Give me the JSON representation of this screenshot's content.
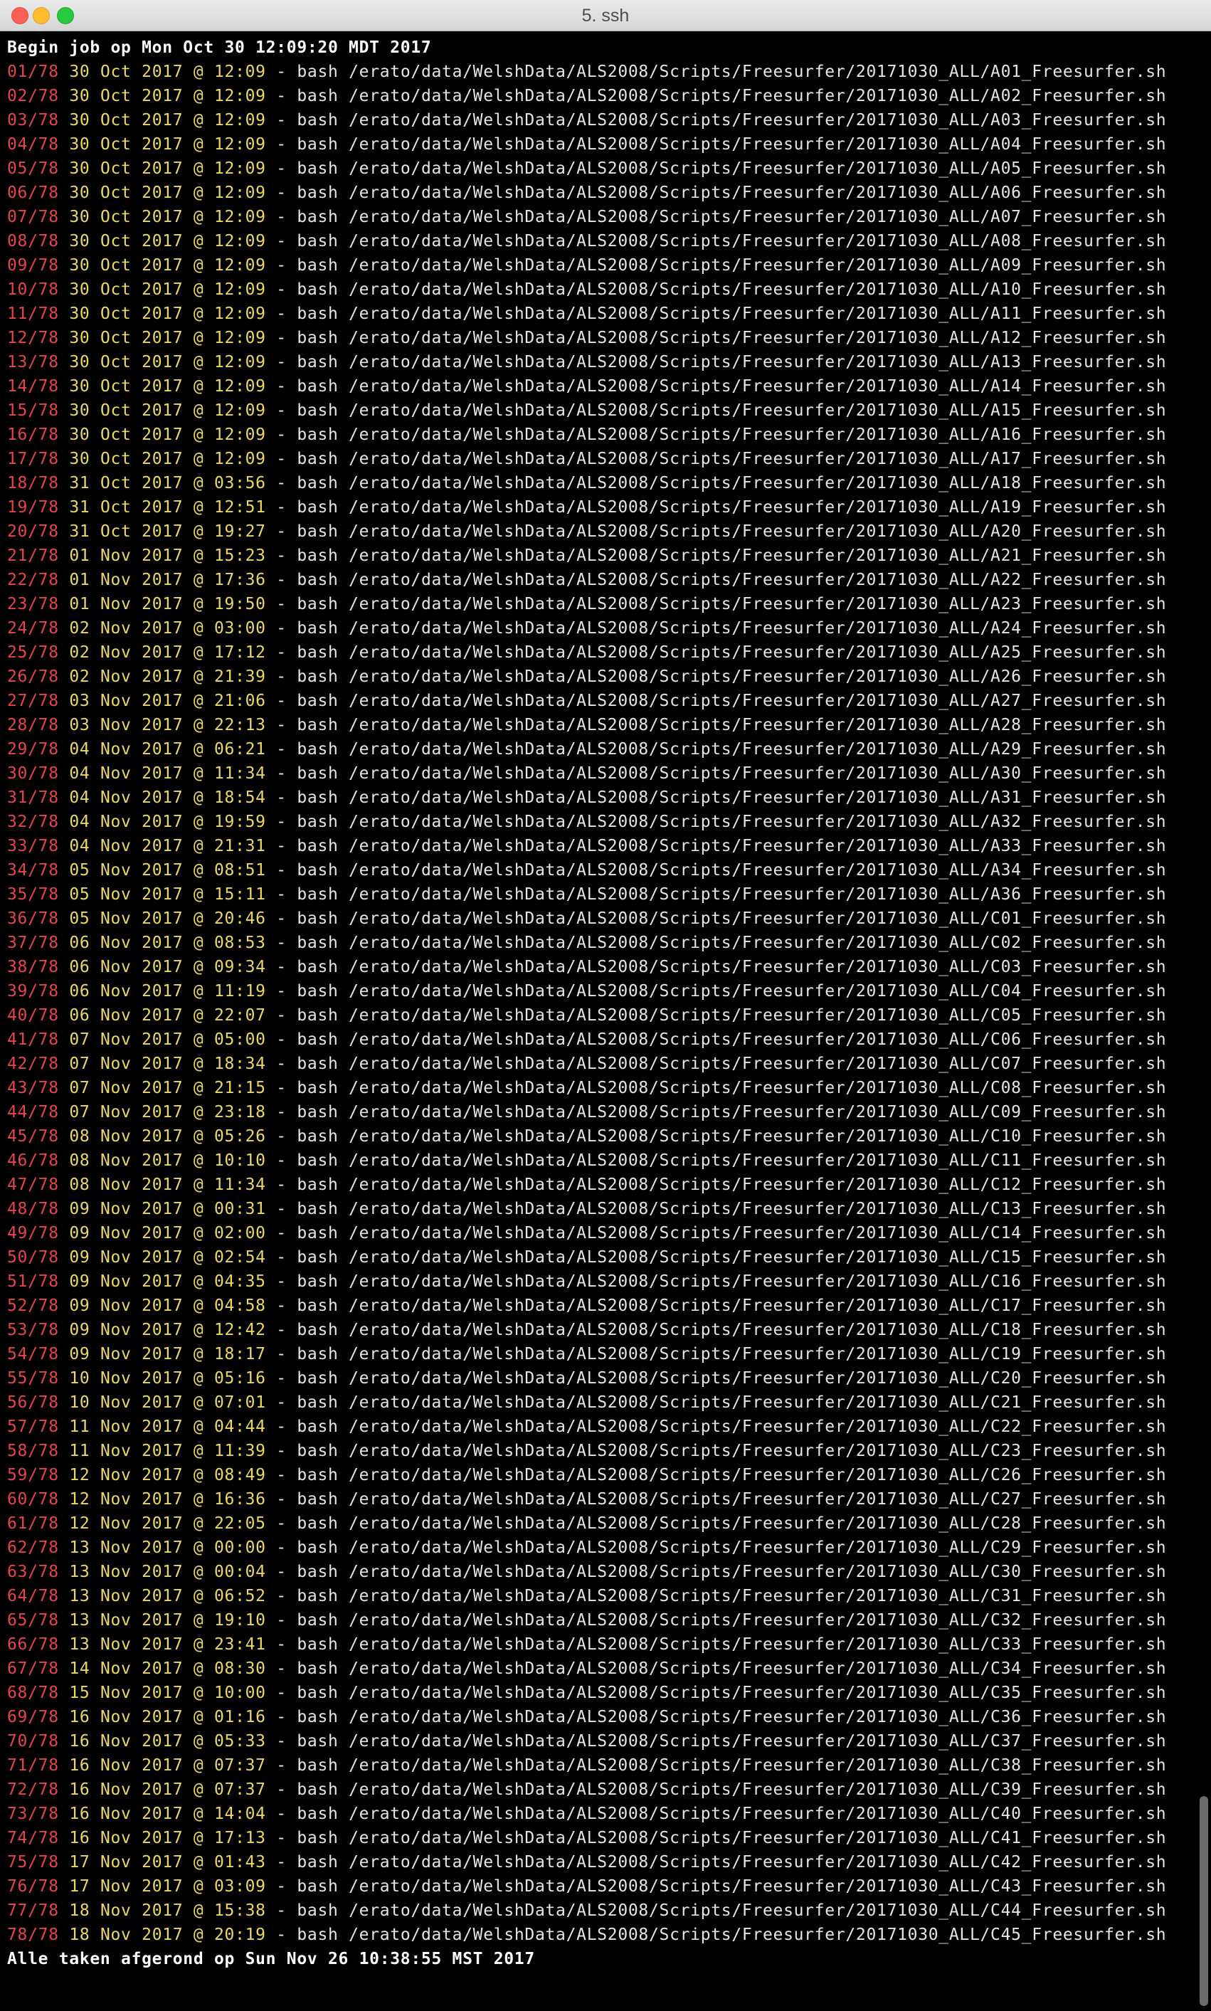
{
  "window": {
    "title": "5. ssh"
  },
  "terminal": {
    "header": "Begin job op Mon Oct 30 12:09:20 MDT 2017",
    "footer": "Alle taken afgerond op Sun Nov 26 10:38:55 MST 2017",
    "separator": " - ",
    "colors": {
      "background": "#000000",
      "index": "#e8434a",
      "date": "#ecd85f",
      "text": "#e5e5e5"
    },
    "jobs": [
      {
        "idx": "01/78",
        "date": "30 Oct 2017 @ 12:09",
        "cmd": "bash /erato/data/WelshData/ALS2008/Scripts/Freesurfer/20171030_ALL/A01_Freesurfer.sh"
      },
      {
        "idx": "02/78",
        "date": "30 Oct 2017 @ 12:09",
        "cmd": "bash /erato/data/WelshData/ALS2008/Scripts/Freesurfer/20171030_ALL/A02_Freesurfer.sh"
      },
      {
        "idx": "03/78",
        "date": "30 Oct 2017 @ 12:09",
        "cmd": "bash /erato/data/WelshData/ALS2008/Scripts/Freesurfer/20171030_ALL/A03_Freesurfer.sh"
      },
      {
        "idx": "04/78",
        "date": "30 Oct 2017 @ 12:09",
        "cmd": "bash /erato/data/WelshData/ALS2008/Scripts/Freesurfer/20171030_ALL/A04_Freesurfer.sh"
      },
      {
        "idx": "05/78",
        "date": "30 Oct 2017 @ 12:09",
        "cmd": "bash /erato/data/WelshData/ALS2008/Scripts/Freesurfer/20171030_ALL/A05_Freesurfer.sh"
      },
      {
        "idx": "06/78",
        "date": "30 Oct 2017 @ 12:09",
        "cmd": "bash /erato/data/WelshData/ALS2008/Scripts/Freesurfer/20171030_ALL/A06_Freesurfer.sh"
      },
      {
        "idx": "07/78",
        "date": "30 Oct 2017 @ 12:09",
        "cmd": "bash /erato/data/WelshData/ALS2008/Scripts/Freesurfer/20171030_ALL/A07_Freesurfer.sh"
      },
      {
        "idx": "08/78",
        "date": "30 Oct 2017 @ 12:09",
        "cmd": "bash /erato/data/WelshData/ALS2008/Scripts/Freesurfer/20171030_ALL/A08_Freesurfer.sh"
      },
      {
        "idx": "09/78",
        "date": "30 Oct 2017 @ 12:09",
        "cmd": "bash /erato/data/WelshData/ALS2008/Scripts/Freesurfer/20171030_ALL/A09_Freesurfer.sh"
      },
      {
        "idx": "10/78",
        "date": "30 Oct 2017 @ 12:09",
        "cmd": "bash /erato/data/WelshData/ALS2008/Scripts/Freesurfer/20171030_ALL/A10_Freesurfer.sh"
      },
      {
        "idx": "11/78",
        "date": "30 Oct 2017 @ 12:09",
        "cmd": "bash /erato/data/WelshData/ALS2008/Scripts/Freesurfer/20171030_ALL/A11_Freesurfer.sh"
      },
      {
        "idx": "12/78",
        "date": "30 Oct 2017 @ 12:09",
        "cmd": "bash /erato/data/WelshData/ALS2008/Scripts/Freesurfer/20171030_ALL/A12_Freesurfer.sh"
      },
      {
        "idx": "13/78",
        "date": "30 Oct 2017 @ 12:09",
        "cmd": "bash /erato/data/WelshData/ALS2008/Scripts/Freesurfer/20171030_ALL/A13_Freesurfer.sh"
      },
      {
        "idx": "14/78",
        "date": "30 Oct 2017 @ 12:09",
        "cmd": "bash /erato/data/WelshData/ALS2008/Scripts/Freesurfer/20171030_ALL/A14_Freesurfer.sh"
      },
      {
        "idx": "15/78",
        "date": "30 Oct 2017 @ 12:09",
        "cmd": "bash /erato/data/WelshData/ALS2008/Scripts/Freesurfer/20171030_ALL/A15_Freesurfer.sh"
      },
      {
        "idx": "16/78",
        "date": "30 Oct 2017 @ 12:09",
        "cmd": "bash /erato/data/WelshData/ALS2008/Scripts/Freesurfer/20171030_ALL/A16_Freesurfer.sh"
      },
      {
        "idx": "17/78",
        "date": "30 Oct 2017 @ 12:09",
        "cmd": "bash /erato/data/WelshData/ALS2008/Scripts/Freesurfer/20171030_ALL/A17_Freesurfer.sh"
      },
      {
        "idx": "18/78",
        "date": "31 Oct 2017 @ 03:56",
        "cmd": "bash /erato/data/WelshData/ALS2008/Scripts/Freesurfer/20171030_ALL/A18_Freesurfer.sh"
      },
      {
        "idx": "19/78",
        "date": "31 Oct 2017 @ 12:51",
        "cmd": "bash /erato/data/WelshData/ALS2008/Scripts/Freesurfer/20171030_ALL/A19_Freesurfer.sh"
      },
      {
        "idx": "20/78",
        "date": "31 Oct 2017 @ 19:27",
        "cmd": "bash /erato/data/WelshData/ALS2008/Scripts/Freesurfer/20171030_ALL/A20_Freesurfer.sh"
      },
      {
        "idx": "21/78",
        "date": "01 Nov 2017 @ 15:23",
        "cmd": "bash /erato/data/WelshData/ALS2008/Scripts/Freesurfer/20171030_ALL/A21_Freesurfer.sh"
      },
      {
        "idx": "22/78",
        "date": "01 Nov 2017 @ 17:36",
        "cmd": "bash /erato/data/WelshData/ALS2008/Scripts/Freesurfer/20171030_ALL/A22_Freesurfer.sh"
      },
      {
        "idx": "23/78",
        "date": "01 Nov 2017 @ 19:50",
        "cmd": "bash /erato/data/WelshData/ALS2008/Scripts/Freesurfer/20171030_ALL/A23_Freesurfer.sh"
      },
      {
        "idx": "24/78",
        "date": "02 Nov 2017 @ 03:00",
        "cmd": "bash /erato/data/WelshData/ALS2008/Scripts/Freesurfer/20171030_ALL/A24_Freesurfer.sh"
      },
      {
        "idx": "25/78",
        "date": "02 Nov 2017 @ 17:12",
        "cmd": "bash /erato/data/WelshData/ALS2008/Scripts/Freesurfer/20171030_ALL/A25_Freesurfer.sh"
      },
      {
        "idx": "26/78",
        "date": "02 Nov 2017 @ 21:39",
        "cmd": "bash /erato/data/WelshData/ALS2008/Scripts/Freesurfer/20171030_ALL/A26_Freesurfer.sh"
      },
      {
        "idx": "27/78",
        "date": "03 Nov 2017 @ 21:06",
        "cmd": "bash /erato/data/WelshData/ALS2008/Scripts/Freesurfer/20171030_ALL/A27_Freesurfer.sh"
      },
      {
        "idx": "28/78",
        "date": "03 Nov 2017 @ 22:13",
        "cmd": "bash /erato/data/WelshData/ALS2008/Scripts/Freesurfer/20171030_ALL/A28_Freesurfer.sh"
      },
      {
        "idx": "29/78",
        "date": "04 Nov 2017 @ 06:21",
        "cmd": "bash /erato/data/WelshData/ALS2008/Scripts/Freesurfer/20171030_ALL/A29_Freesurfer.sh"
      },
      {
        "idx": "30/78",
        "date": "04 Nov 2017 @ 11:34",
        "cmd": "bash /erato/data/WelshData/ALS2008/Scripts/Freesurfer/20171030_ALL/A30_Freesurfer.sh"
      },
      {
        "idx": "31/78",
        "date": "04 Nov 2017 @ 18:54",
        "cmd": "bash /erato/data/WelshData/ALS2008/Scripts/Freesurfer/20171030_ALL/A31_Freesurfer.sh"
      },
      {
        "idx": "32/78",
        "date": "04 Nov 2017 @ 19:59",
        "cmd": "bash /erato/data/WelshData/ALS2008/Scripts/Freesurfer/20171030_ALL/A32_Freesurfer.sh"
      },
      {
        "idx": "33/78",
        "date": "04 Nov 2017 @ 21:31",
        "cmd": "bash /erato/data/WelshData/ALS2008/Scripts/Freesurfer/20171030_ALL/A33_Freesurfer.sh"
      },
      {
        "idx": "34/78",
        "date": "05 Nov 2017 @ 08:51",
        "cmd": "bash /erato/data/WelshData/ALS2008/Scripts/Freesurfer/20171030_ALL/A34_Freesurfer.sh"
      },
      {
        "idx": "35/78",
        "date": "05 Nov 2017 @ 15:11",
        "cmd": "bash /erato/data/WelshData/ALS2008/Scripts/Freesurfer/20171030_ALL/A36_Freesurfer.sh"
      },
      {
        "idx": "36/78",
        "date": "05 Nov 2017 @ 20:46",
        "cmd": "bash /erato/data/WelshData/ALS2008/Scripts/Freesurfer/20171030_ALL/C01_Freesurfer.sh"
      },
      {
        "idx": "37/78",
        "date": "06 Nov 2017 @ 08:53",
        "cmd": "bash /erato/data/WelshData/ALS2008/Scripts/Freesurfer/20171030_ALL/C02_Freesurfer.sh"
      },
      {
        "idx": "38/78",
        "date": "06 Nov 2017 @ 09:34",
        "cmd": "bash /erato/data/WelshData/ALS2008/Scripts/Freesurfer/20171030_ALL/C03_Freesurfer.sh"
      },
      {
        "idx": "39/78",
        "date": "06 Nov 2017 @ 11:19",
        "cmd": "bash /erato/data/WelshData/ALS2008/Scripts/Freesurfer/20171030_ALL/C04_Freesurfer.sh"
      },
      {
        "idx": "40/78",
        "date": "06 Nov 2017 @ 22:07",
        "cmd": "bash /erato/data/WelshData/ALS2008/Scripts/Freesurfer/20171030_ALL/C05_Freesurfer.sh"
      },
      {
        "idx": "41/78",
        "date": "07 Nov 2017 @ 05:00",
        "cmd": "bash /erato/data/WelshData/ALS2008/Scripts/Freesurfer/20171030_ALL/C06_Freesurfer.sh"
      },
      {
        "idx": "42/78",
        "date": "07 Nov 2017 @ 18:34",
        "cmd": "bash /erato/data/WelshData/ALS2008/Scripts/Freesurfer/20171030_ALL/C07_Freesurfer.sh"
      },
      {
        "idx": "43/78",
        "date": "07 Nov 2017 @ 21:15",
        "cmd": "bash /erato/data/WelshData/ALS2008/Scripts/Freesurfer/20171030_ALL/C08_Freesurfer.sh"
      },
      {
        "idx": "44/78",
        "date": "07 Nov 2017 @ 23:18",
        "cmd": "bash /erato/data/WelshData/ALS2008/Scripts/Freesurfer/20171030_ALL/C09_Freesurfer.sh"
      },
      {
        "idx": "45/78",
        "date": "08 Nov 2017 @ 05:26",
        "cmd": "bash /erato/data/WelshData/ALS2008/Scripts/Freesurfer/20171030_ALL/C10_Freesurfer.sh"
      },
      {
        "idx": "46/78",
        "date": "08 Nov 2017 @ 10:10",
        "cmd": "bash /erato/data/WelshData/ALS2008/Scripts/Freesurfer/20171030_ALL/C11_Freesurfer.sh"
      },
      {
        "idx": "47/78",
        "date": "08 Nov 2017 @ 11:34",
        "cmd": "bash /erato/data/WelshData/ALS2008/Scripts/Freesurfer/20171030_ALL/C12_Freesurfer.sh"
      },
      {
        "idx": "48/78",
        "date": "09 Nov 2017 @ 00:31",
        "cmd": "bash /erato/data/WelshData/ALS2008/Scripts/Freesurfer/20171030_ALL/C13_Freesurfer.sh"
      },
      {
        "idx": "49/78",
        "date": "09 Nov 2017 @ 02:00",
        "cmd": "bash /erato/data/WelshData/ALS2008/Scripts/Freesurfer/20171030_ALL/C14_Freesurfer.sh"
      },
      {
        "idx": "50/78",
        "date": "09 Nov 2017 @ 02:54",
        "cmd": "bash /erato/data/WelshData/ALS2008/Scripts/Freesurfer/20171030_ALL/C15_Freesurfer.sh"
      },
      {
        "idx": "51/78",
        "date": "09 Nov 2017 @ 04:35",
        "cmd": "bash /erato/data/WelshData/ALS2008/Scripts/Freesurfer/20171030_ALL/C16_Freesurfer.sh"
      },
      {
        "idx": "52/78",
        "date": "09 Nov 2017 @ 04:58",
        "cmd": "bash /erato/data/WelshData/ALS2008/Scripts/Freesurfer/20171030_ALL/C17_Freesurfer.sh"
      },
      {
        "idx": "53/78",
        "date": "09 Nov 2017 @ 12:42",
        "cmd": "bash /erato/data/WelshData/ALS2008/Scripts/Freesurfer/20171030_ALL/C18_Freesurfer.sh"
      },
      {
        "idx": "54/78",
        "date": "09 Nov 2017 @ 18:17",
        "cmd": "bash /erato/data/WelshData/ALS2008/Scripts/Freesurfer/20171030_ALL/C19_Freesurfer.sh"
      },
      {
        "idx": "55/78",
        "date": "10 Nov 2017 @ 05:16",
        "cmd": "bash /erato/data/WelshData/ALS2008/Scripts/Freesurfer/20171030_ALL/C20_Freesurfer.sh"
      },
      {
        "idx": "56/78",
        "date": "10 Nov 2017 @ 07:01",
        "cmd": "bash /erato/data/WelshData/ALS2008/Scripts/Freesurfer/20171030_ALL/C21_Freesurfer.sh"
      },
      {
        "idx": "57/78",
        "date": "11 Nov 2017 @ 04:44",
        "cmd": "bash /erato/data/WelshData/ALS2008/Scripts/Freesurfer/20171030_ALL/C22_Freesurfer.sh"
      },
      {
        "idx": "58/78",
        "date": "11 Nov 2017 @ 11:39",
        "cmd": "bash /erato/data/WelshData/ALS2008/Scripts/Freesurfer/20171030_ALL/C23_Freesurfer.sh"
      },
      {
        "idx": "59/78",
        "date": "12 Nov 2017 @ 08:49",
        "cmd": "bash /erato/data/WelshData/ALS2008/Scripts/Freesurfer/20171030_ALL/C26_Freesurfer.sh"
      },
      {
        "idx": "60/78",
        "date": "12 Nov 2017 @ 16:36",
        "cmd": "bash /erato/data/WelshData/ALS2008/Scripts/Freesurfer/20171030_ALL/C27_Freesurfer.sh"
      },
      {
        "idx": "61/78",
        "date": "12 Nov 2017 @ 22:05",
        "cmd": "bash /erato/data/WelshData/ALS2008/Scripts/Freesurfer/20171030_ALL/C28_Freesurfer.sh"
      },
      {
        "idx": "62/78",
        "date": "13 Nov 2017 @ 00:00",
        "cmd": "bash /erato/data/WelshData/ALS2008/Scripts/Freesurfer/20171030_ALL/C29_Freesurfer.sh"
      },
      {
        "idx": "63/78",
        "date": "13 Nov 2017 @ 00:04",
        "cmd": "bash /erato/data/WelshData/ALS2008/Scripts/Freesurfer/20171030_ALL/C30_Freesurfer.sh"
      },
      {
        "idx": "64/78",
        "date": "13 Nov 2017 @ 06:52",
        "cmd": "bash /erato/data/WelshData/ALS2008/Scripts/Freesurfer/20171030_ALL/C31_Freesurfer.sh"
      },
      {
        "idx": "65/78",
        "date": "13 Nov 2017 @ 19:10",
        "cmd": "bash /erato/data/WelshData/ALS2008/Scripts/Freesurfer/20171030_ALL/C32_Freesurfer.sh"
      },
      {
        "idx": "66/78",
        "date": "13 Nov 2017 @ 23:41",
        "cmd": "bash /erato/data/WelshData/ALS2008/Scripts/Freesurfer/20171030_ALL/C33_Freesurfer.sh"
      },
      {
        "idx": "67/78",
        "date": "14 Nov 2017 @ 08:30",
        "cmd": "bash /erato/data/WelshData/ALS2008/Scripts/Freesurfer/20171030_ALL/C34_Freesurfer.sh"
      },
      {
        "idx": "68/78",
        "date": "15 Nov 2017 @ 10:00",
        "cmd": "bash /erato/data/WelshData/ALS2008/Scripts/Freesurfer/20171030_ALL/C35_Freesurfer.sh"
      },
      {
        "idx": "69/78",
        "date": "16 Nov 2017 @ 01:16",
        "cmd": "bash /erato/data/WelshData/ALS2008/Scripts/Freesurfer/20171030_ALL/C36_Freesurfer.sh"
      },
      {
        "idx": "70/78",
        "date": "16 Nov 2017 @ 05:33",
        "cmd": "bash /erato/data/WelshData/ALS2008/Scripts/Freesurfer/20171030_ALL/C37_Freesurfer.sh"
      },
      {
        "idx": "71/78",
        "date": "16 Nov 2017 @ 07:37",
        "cmd": "bash /erato/data/WelshData/ALS2008/Scripts/Freesurfer/20171030_ALL/C38_Freesurfer.sh"
      },
      {
        "idx": "72/78",
        "date": "16 Nov 2017 @ 07:37",
        "cmd": "bash /erato/data/WelshData/ALS2008/Scripts/Freesurfer/20171030_ALL/C39_Freesurfer.sh"
      },
      {
        "idx": "73/78",
        "date": "16 Nov 2017 @ 14:04",
        "cmd": "bash /erato/data/WelshData/ALS2008/Scripts/Freesurfer/20171030_ALL/C40_Freesurfer.sh"
      },
      {
        "idx": "74/78",
        "date": "16 Nov 2017 @ 17:13",
        "cmd": "bash /erato/data/WelshData/ALS2008/Scripts/Freesurfer/20171030_ALL/C41_Freesurfer.sh"
      },
      {
        "idx": "75/78",
        "date": "17 Nov 2017 @ 01:43",
        "cmd": "bash /erato/data/WelshData/ALS2008/Scripts/Freesurfer/20171030_ALL/C42_Freesurfer.sh"
      },
      {
        "idx": "76/78",
        "date": "17 Nov 2017 @ 03:09",
        "cmd": "bash /erato/data/WelshData/ALS2008/Scripts/Freesurfer/20171030_ALL/C43_Freesurfer.sh"
      },
      {
        "idx": "77/78",
        "date": "18 Nov 2017 @ 15:38",
        "cmd": "bash /erato/data/WelshData/ALS2008/Scripts/Freesurfer/20171030_ALL/C44_Freesurfer.sh"
      },
      {
        "idx": "78/78",
        "date": "18 Nov 2017 @ 20:19",
        "cmd": "bash /erato/data/WelshData/ALS2008/Scripts/Freesurfer/20171030_ALL/C45_Freesurfer.sh"
      }
    ]
  }
}
